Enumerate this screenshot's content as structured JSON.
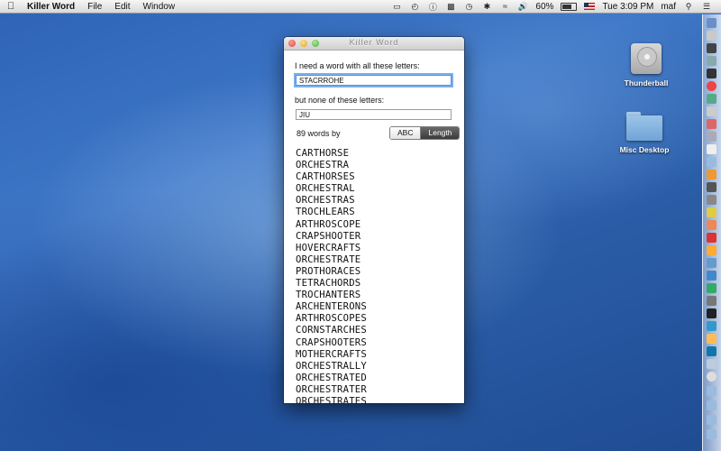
{
  "menubar": {
    "app_name": "Killer Word",
    "menus": [
      "File",
      "Edit",
      "Window"
    ],
    "battery_percent": "60%",
    "clock": "Tue 3:09 PM",
    "user": "maf"
  },
  "window": {
    "title": "Killer Word",
    "include_label": "I need a word with all these letters:",
    "include_value": "STACRROHE",
    "exclude_label": "but none of these letters:",
    "exclude_value": "JIU",
    "count_label": "89 words by",
    "sort_options": [
      "ABC",
      "Length"
    ],
    "sort_selected": "Length",
    "words": [
      "CARTHORSE",
      "ORCHESTRA",
      "CARTHORSES",
      "ORCHESTRAL",
      "ORCHESTRAS",
      "TROCHLEARS",
      "ARTHROSCOPE",
      "CRAPSHOOTER",
      "HOVERCRAFTS",
      "ORCHESTRATE",
      "PROTHORACES",
      "TETRACHORDS",
      "TROCHANTERS",
      "ARCHENTERONS",
      "ARTHROSCOPES",
      "CORNSTARCHES",
      "CRAPSHOOTERS",
      "MOTHERCRAFTS",
      "ORCHESTRALLY",
      "ORCHESTRATED",
      "ORCHESTRATER",
      "ORCHESTRATES"
    ]
  },
  "desktop": {
    "icons": [
      {
        "label": "Thunderball",
        "icon": "hard-drive-icon"
      },
      {
        "label": "Misc Desktop",
        "icon": "folder-icon"
      }
    ]
  },
  "colors": {
    "desktop_blue": "#2e63b5",
    "selected_segment": "#4a4a4a",
    "focus_ring": "#7ab0ef"
  }
}
